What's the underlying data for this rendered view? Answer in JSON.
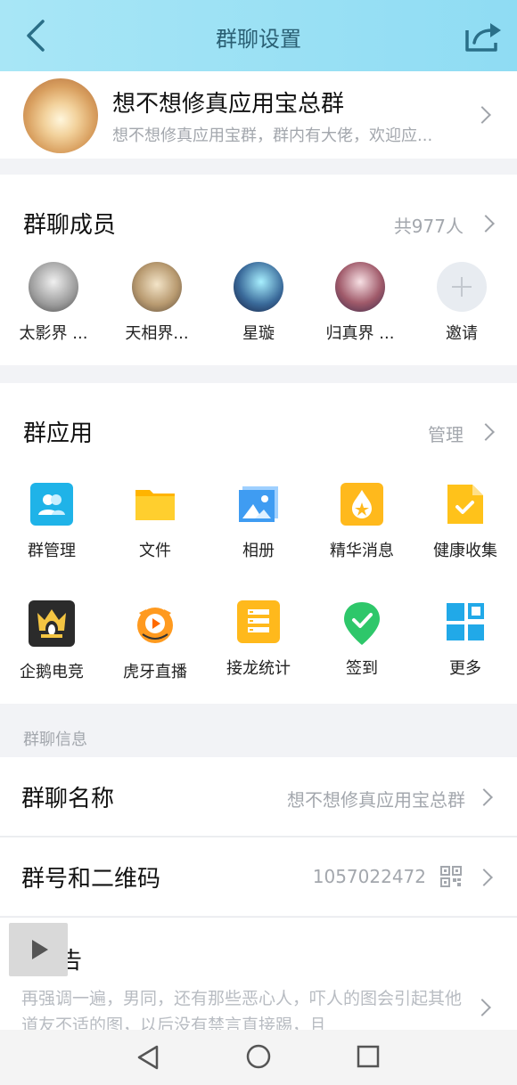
{
  "header": {
    "title": "群聊设置",
    "back_icon": "back-icon",
    "share_icon": "share-icon"
  },
  "group": {
    "name": "想不想修真应用宝总群",
    "description": "想不想修真应用宝群，群内有大佬，欢迎应..."
  },
  "members": {
    "title": "群聊成员",
    "count": "共977人",
    "list": [
      {
        "name": "太影界 ..."
      },
      {
        "name": "天相界..."
      },
      {
        "name": "星璇"
      },
      {
        "name": "归真界 ..."
      },
      {
        "name": "邀请"
      }
    ]
  },
  "apps": {
    "title": "群应用",
    "manage": "管理",
    "items": [
      {
        "label": "群管理",
        "icon": "group-manage-icon",
        "color": "#1fb3e8"
      },
      {
        "label": "文件",
        "icon": "folder-icon",
        "color": "#ffc21a"
      },
      {
        "label": "相册",
        "icon": "album-icon",
        "color": "#3f9cf2"
      },
      {
        "label": "精华消息",
        "icon": "essence-icon",
        "color": "#ffb91c"
      },
      {
        "label": "健康收集",
        "icon": "health-collect-icon",
        "color": "#ffc21a"
      },
      {
        "label": "企鹅电竞",
        "icon": "penguin-esports-icon",
        "color": "#2b2b2b"
      },
      {
        "label": "虎牙直播",
        "icon": "huya-live-icon",
        "color": "#ff9a1f"
      },
      {
        "label": "接龙统计",
        "icon": "relay-stats-icon",
        "color": "#ffb91c"
      },
      {
        "label": "签到",
        "icon": "checkin-icon",
        "color": "#2ec76a"
      },
      {
        "label": "更多",
        "icon": "more-grid-icon",
        "color": "#21a9e8"
      }
    ]
  },
  "info": {
    "section_label": "群聊信息",
    "name_label": "群聊名称",
    "name_value": "想不想修真应用宝总群",
    "number_label": "群号和二维码",
    "number_value": "1057022472",
    "notice_label": "群公告",
    "notice_label_visible": "告",
    "notice_text": "再强调一遍，男同，还有那些恶心人，吓人的图会引起其他道友不适的图，以后没有禁言直接踢，且"
  },
  "nav": {
    "back": "nav-back-icon",
    "home": "nav-home-icon",
    "recent": "nav-recent-icon"
  }
}
